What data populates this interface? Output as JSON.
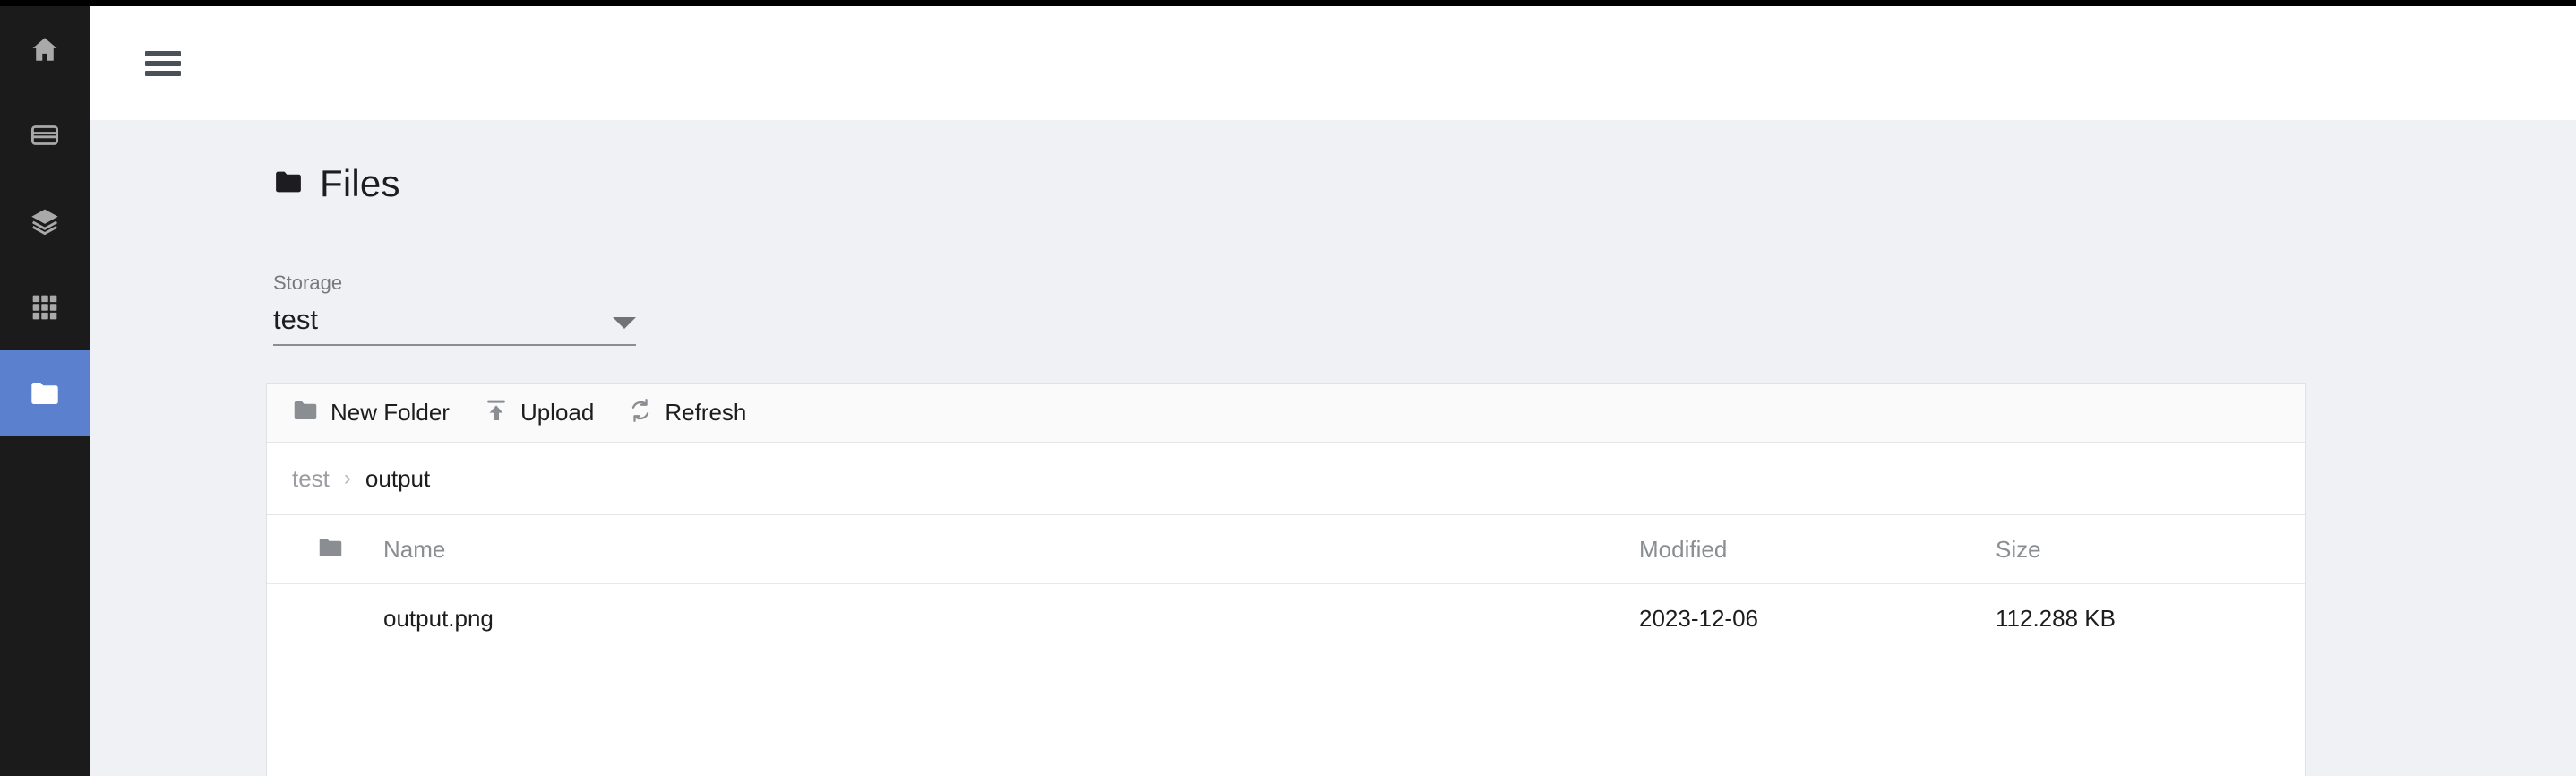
{
  "sidebar": {
    "items": [
      {
        "icon": "home-icon",
        "active": false
      },
      {
        "icon": "credit-card-icon",
        "active": false
      },
      {
        "icon": "layers-icon",
        "active": false
      },
      {
        "icon": "grid-icon",
        "active": false
      },
      {
        "icon": "folder-icon",
        "active": true
      }
    ],
    "active_color": "#5b81ce",
    "background": "#1b1b1b"
  },
  "header": {
    "menu_icon": "hamburger-icon"
  },
  "page": {
    "title": "Files",
    "title_icon": "folder-icon"
  },
  "storage": {
    "label": "Storage",
    "value": "test",
    "caret_icon": "chevron-down-icon"
  },
  "toolbar": {
    "new_folder_label": "New Folder",
    "new_folder_icon": "folder-icon",
    "upload_label": "Upload",
    "upload_icon": "upload-icon",
    "refresh_label": "Refresh",
    "refresh_icon": "refresh-icon"
  },
  "breadcrumb": {
    "separator": "›",
    "items": [
      {
        "label": "test",
        "current": false
      },
      {
        "label": "output",
        "current": true
      }
    ]
  },
  "table": {
    "columns": {
      "name": "Name",
      "modified": "Modified",
      "size": "Size"
    },
    "header_icon": "folder-icon",
    "rows": [
      {
        "name": "output.png",
        "modified": "2023-12-06",
        "size": "112.288 KB"
      }
    ]
  }
}
